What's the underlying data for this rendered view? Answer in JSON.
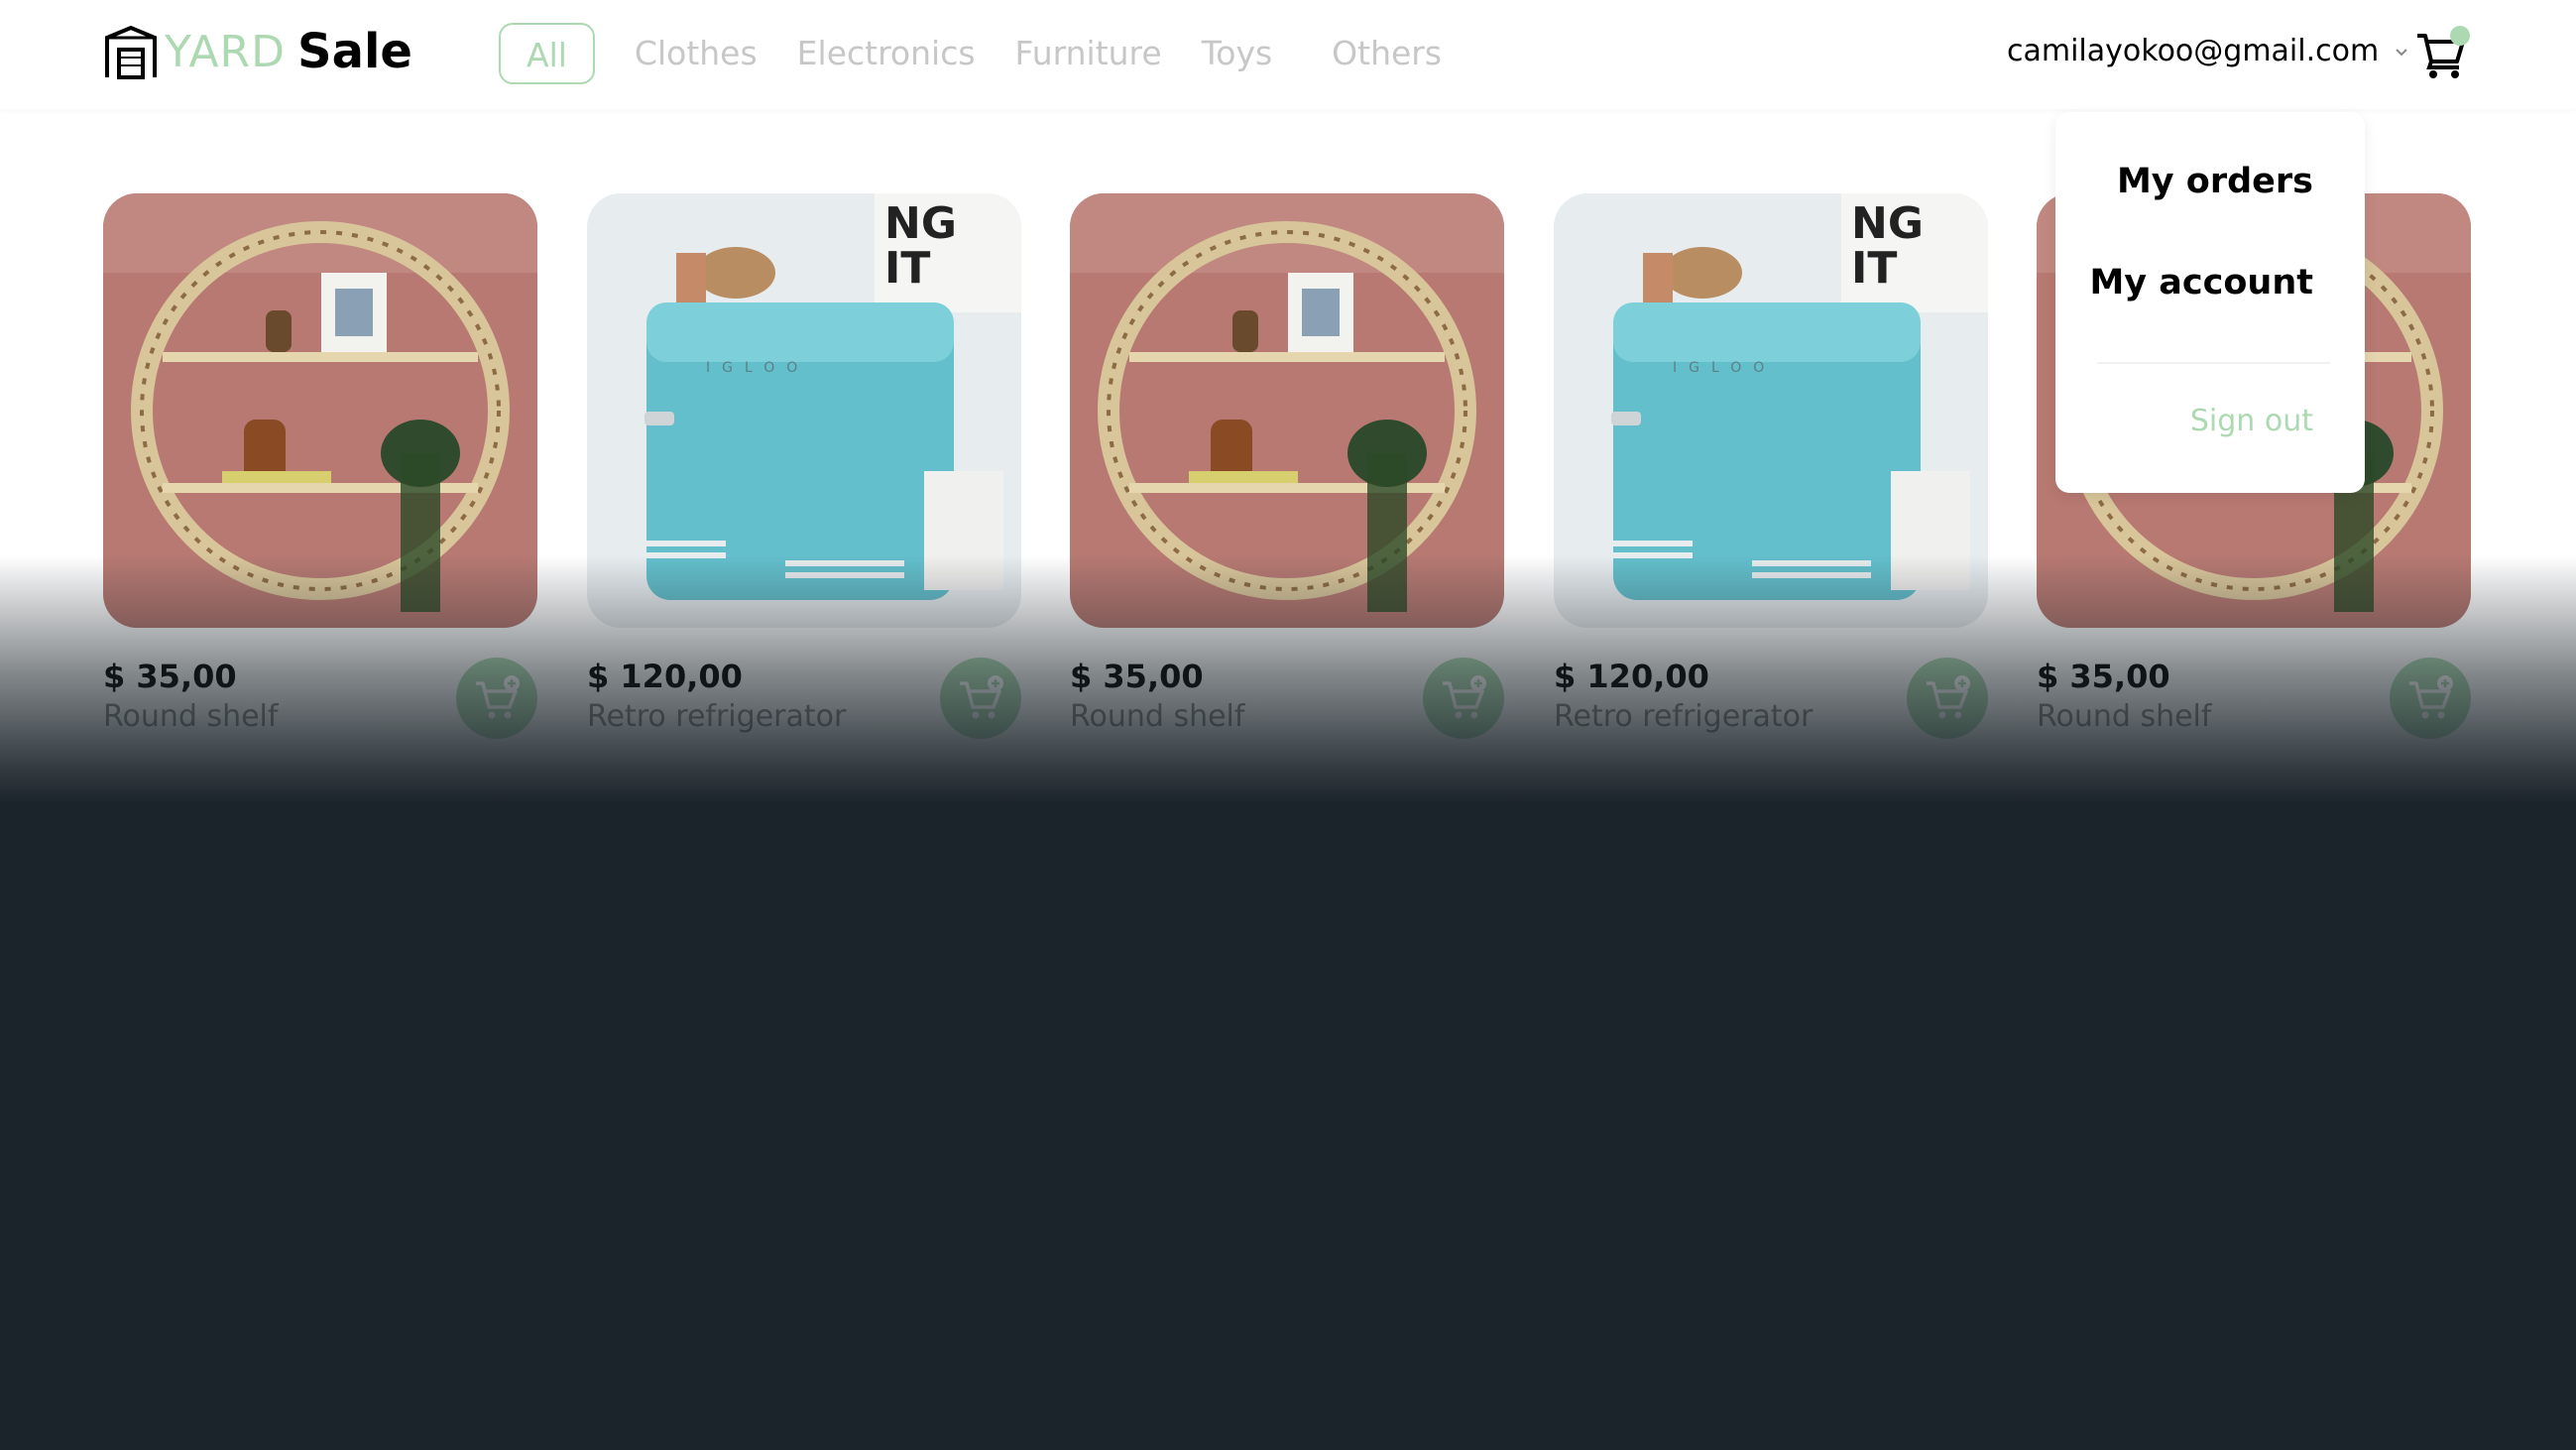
{
  "header": {
    "logo_yard": "YARD",
    "logo_sale": "Sale",
    "nav": [
      {
        "label": "All",
        "active": true
      },
      {
        "label": "Clothes",
        "active": false
      },
      {
        "label": "Electronics",
        "active": false
      },
      {
        "label": "Furniture",
        "active": false
      },
      {
        "label": "Toys",
        "active": false
      },
      {
        "label": "Others",
        "active": false
      }
    ],
    "user_email": "camilayokoo@gmail.com",
    "cart_icon": "shopping-cart-icon",
    "cart_has_items": true
  },
  "menu": {
    "items": [
      "My orders",
      "My account"
    ],
    "sign_out": "Sign out"
  },
  "products": [
    {
      "price": "$ 35,00",
      "name": "Round shelf",
      "image": "round-shelf"
    },
    {
      "price": "$ 120,00",
      "name": "Retro refrigerator",
      "image": "retro-refrigerator"
    },
    {
      "price": "$ 35,00",
      "name": "Round shelf",
      "image": "round-shelf"
    },
    {
      "price": "$ 120,00",
      "name": "Retro refrigerator",
      "image": "retro-refrigerator"
    },
    {
      "price": "$ 35,00",
      "name": "Round shelf",
      "image": "round-shelf"
    }
  ],
  "colors": {
    "accent": "#acd9b2",
    "overlay": "#1b242a",
    "muted_text": "#c7c7c7"
  }
}
